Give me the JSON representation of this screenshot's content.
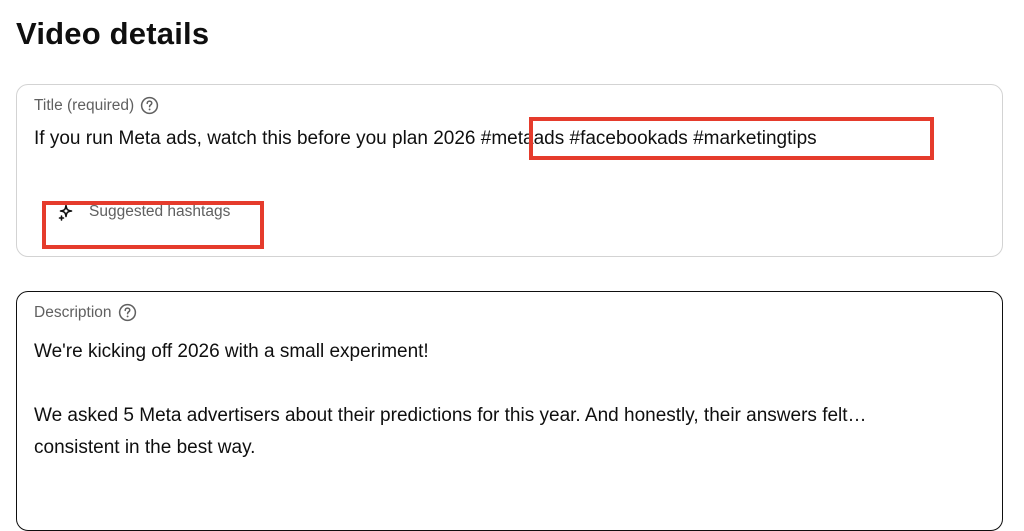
{
  "page": {
    "title": "Video details"
  },
  "title_field": {
    "label": "Title (required)",
    "value_main": "If you run Meta ads, watch this before you plan 2026",
    "value_hashtags": " #metaads #facebookads #marketingtips",
    "help_icon": "question-circle-icon",
    "suggest_label": "Suggested hashtags",
    "suggest_icon": "sparkle-icon"
  },
  "description_field": {
    "label": "Description",
    "help_icon": "question-circle-icon",
    "lines": [
      "We're kicking off 2026 with a small experiment!",
      "We asked 5 Meta advertisers about their predictions for this year. And honestly, their answers felt…",
      "consistent in the best way."
    ]
  },
  "colors": {
    "highlight": "#e53b2c",
    "label": "#606060",
    "text": "#0f0f0f",
    "border_idle": "#d3d3d3",
    "border_focus": "#0f0f0f"
  }
}
